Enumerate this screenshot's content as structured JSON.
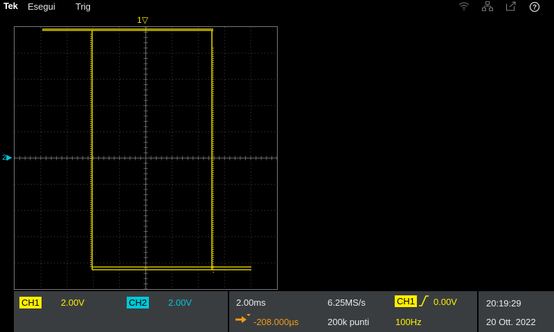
{
  "topbar": {
    "logo": "Tek",
    "menu": [
      "Esegui",
      "Trig"
    ],
    "icons": [
      "wifi-icon",
      "network-icon",
      "export-icon",
      "help-icon"
    ]
  },
  "waveform": {
    "ch1_marker": "1",
    "ch2_marker": "2",
    "ch1_color": "#ffee00",
    "ch2_color": "#00c8d8"
  },
  "channels": {
    "ch1": {
      "label": "CH1",
      "scale": "2.00V"
    },
    "ch2": {
      "label": "CH2",
      "scale": "2.00V"
    }
  },
  "horizontal": {
    "scale": "2.00ms",
    "position": "-208.000µs",
    "sample_rate": "6.25MS/s",
    "record_length": "200k punti"
  },
  "trigger": {
    "source": "CH1",
    "level": "0.00V",
    "frequency": "100Hz"
  },
  "datetime": {
    "time": "20:19:29",
    "date": "20 Ott. 2022"
  }
}
